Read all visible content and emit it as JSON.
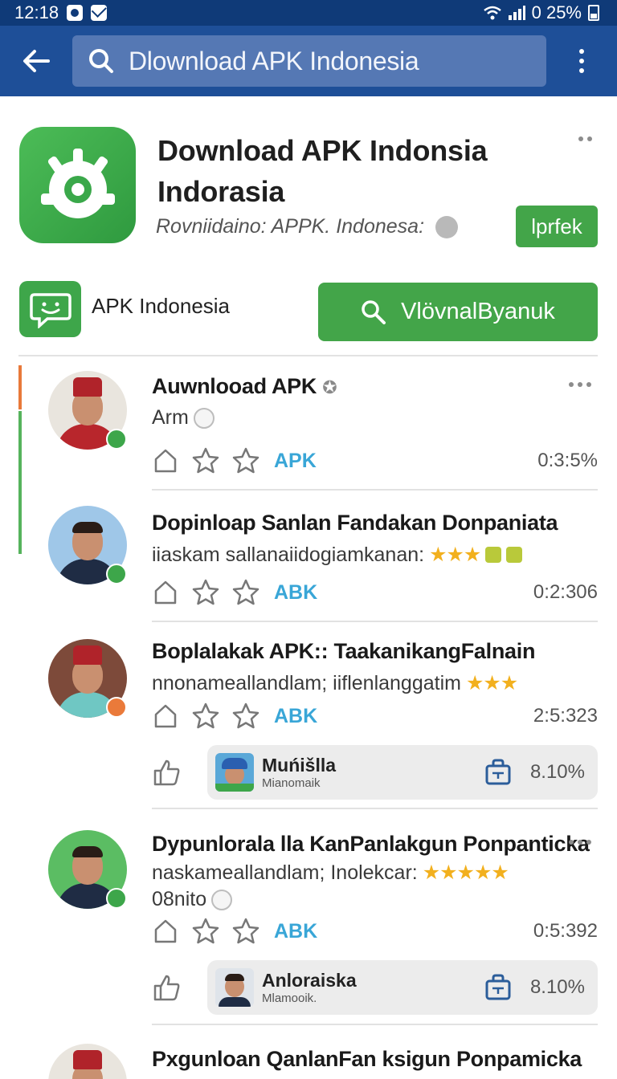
{
  "status_bar": {
    "time": "12:18",
    "battery": "0 25%"
  },
  "app_bar": {
    "search_text": "Dlownload APK Indonesia"
  },
  "header": {
    "title_line1": "Download APK Indonsia",
    "title_line2": "Indorasia",
    "subtitle": "Rovniidaino: APPK. Indonesa:",
    "install_label": "lprfek"
  },
  "publisher": {
    "name": "APK Indonesia",
    "button_label": "VlövnalByanuk"
  },
  "items": [
    {
      "title": "Auwnlooad APK",
      "subtitle": "Arm",
      "tag": "APK",
      "value": "0:3:5%"
    },
    {
      "title": "Dopinloap Sanlan Fandakan Donpaniata",
      "subtitle": "iiaskam  sallanaiidogiamkanan:",
      "stars": "★★★",
      "tag": "ABK",
      "value": "0:2:306"
    },
    {
      "title": "Boplalakak APK:: TaakanikangFalnain",
      "subtitle": "nnonameallandlam; iiflenlanggatim",
      "stars": "★★★",
      "tag": "ABK",
      "value": "2:5:323",
      "card": {
        "name": "Muńišlla",
        "meta": "Mianomaik",
        "pct": "8.10%"
      }
    },
    {
      "title": "Dypunlorala lla KanPanlakgun Ponpanticka",
      "subtitle": "naskameallandlam; Inolekcar:",
      "stars": "★★★★★",
      "extra": "08nito",
      "tag": "ABK",
      "value": "0:5:392",
      "card": {
        "name": "Anloraiska",
        "meta": "Mlamooik.",
        "pct": "8.10%"
      }
    },
    {
      "title": "Pxgunloan QanlanFan ksigun Ponpamicka"
    }
  ],
  "colors": {
    "status_bar": "#0f3a78",
    "app_bar": "#1e4f98",
    "accent_green": "#43a549",
    "tag_blue": "#39a6d7",
    "star": "#f2b01e"
  }
}
